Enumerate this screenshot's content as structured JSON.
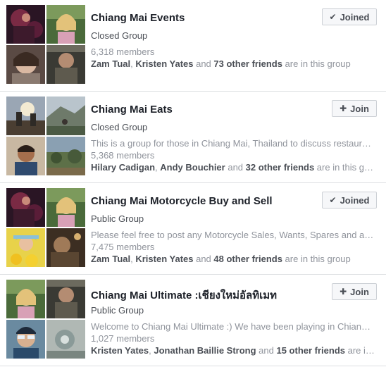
{
  "groups": [
    {
      "name": "Chiang Mai Events",
      "type": "Closed Group",
      "description": "",
      "members": "6,318 members",
      "friends_a": "Zam Tual",
      "friends_sep": ", ",
      "friends_b": "Kristen Yates",
      "friends_and": " and ",
      "friends_other": "73 other friends",
      "friends_tail": " are in this group",
      "button_label": "Joined",
      "button_icon": "check-icon",
      "button_glyph": "✔"
    },
    {
      "name": "Chiang Mai Eats",
      "type": "Closed Group",
      "description": "This is a group for those in Chiang Mai, Thailand to discuss restaurants",
      "members": "5,368 members",
      "friends_a": "Hilary Cadigan",
      "friends_sep": ", ",
      "friends_b": "Andy Bouchier",
      "friends_and": " and ",
      "friends_other": "32 other friends",
      "friends_tail": " are in this group",
      "button_label": "Join",
      "button_icon": "add-group-icon",
      "button_glyph": "✚"
    },
    {
      "name": "Chiang Mai Motorcycle Buy and Sell",
      "type": "Public Group",
      "description": "Please feel free to post any Motorcycle Sales, Wants, Spares and accessories",
      "members": "7,475 members",
      "friends_a": "Zam Tual",
      "friends_sep": ", ",
      "friends_b": "Kristen Yates",
      "friends_and": " and ",
      "friends_other": "48 other friends",
      "friends_tail": " are in this group",
      "button_label": "Joined",
      "button_icon": "check-icon",
      "button_glyph": "✔"
    },
    {
      "name": "Chiang Mai Ultimate :เชียงใหม่อัลทิเมท",
      "type": "Public Group",
      "description": "Welcome to Chiang Mai Ultimate :) We have been playing in Chiang Mai",
      "members": "1,027 members",
      "friends_a": "Kristen Yates",
      "friends_sep": ", ",
      "friends_b": "Jonathan Baillie Strong",
      "friends_and": " and ",
      "friends_other": "15 other friends",
      "friends_tail": " are in this group",
      "button_label": "Join",
      "button_icon": "add-group-icon",
      "button_glyph": "✚"
    }
  ]
}
